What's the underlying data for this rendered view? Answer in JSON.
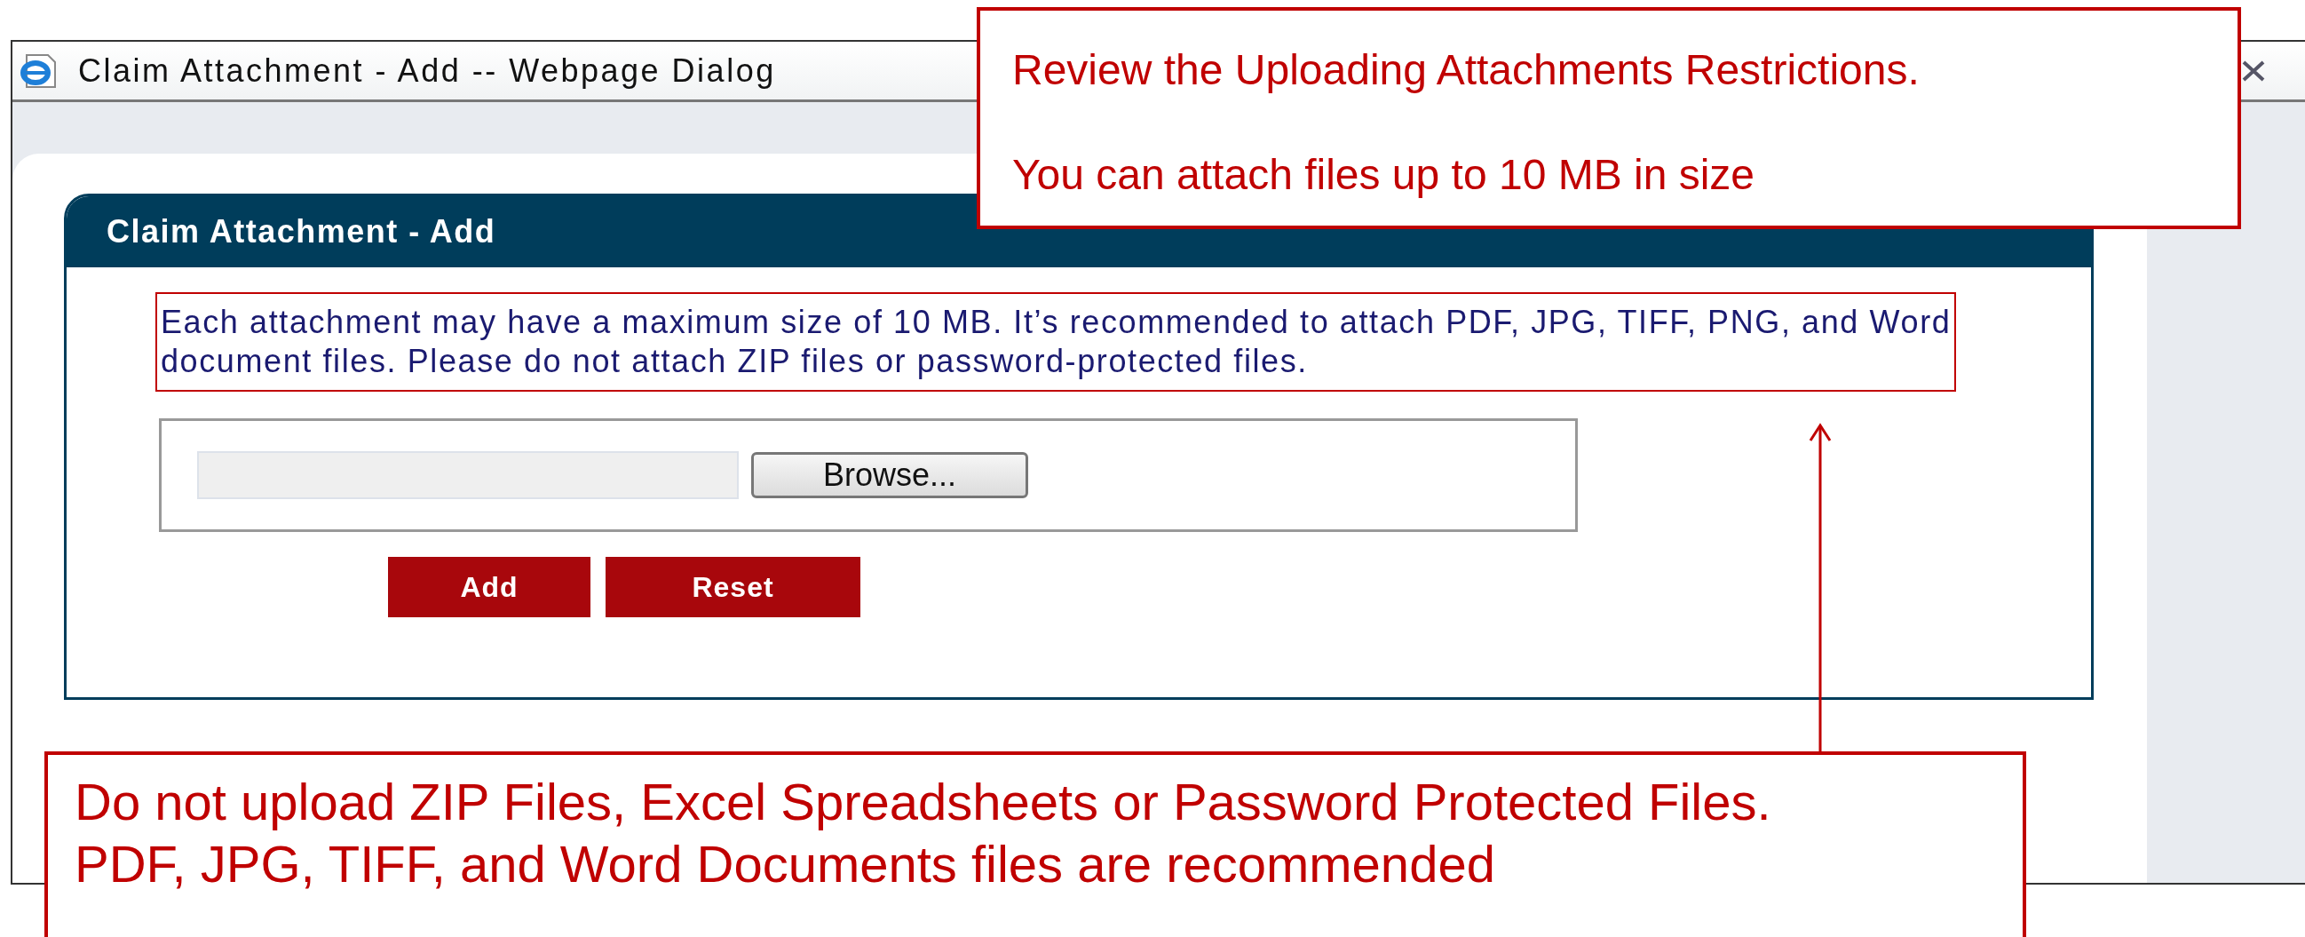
{
  "window": {
    "title": "Claim Attachment - Add -- Webpage Dialog"
  },
  "panel": {
    "title": "Claim Attachment - Add",
    "notice": "Each attachment may have a maximum size of 10 MB. It’s recommended to attach PDF, JPG, TIFF, PNG, and Word document files. Please do not attach ZIP files or password-protected files.",
    "browse_button": "Browse...",
    "buttons": [
      "Add",
      "Reset"
    ]
  },
  "callouts": [
    {
      "lines": [
        "Review the Uploading Attachments Restrictions.",
        "You can attach files up to 10 MB in size"
      ]
    },
    {
      "lines": [
        "Do not upload ZIP Files, Excel Spreadsheets or Password Protected Files.",
        "PDF, JPG, TIFF, and Word Documents files are recommended"
      ]
    }
  ]
}
